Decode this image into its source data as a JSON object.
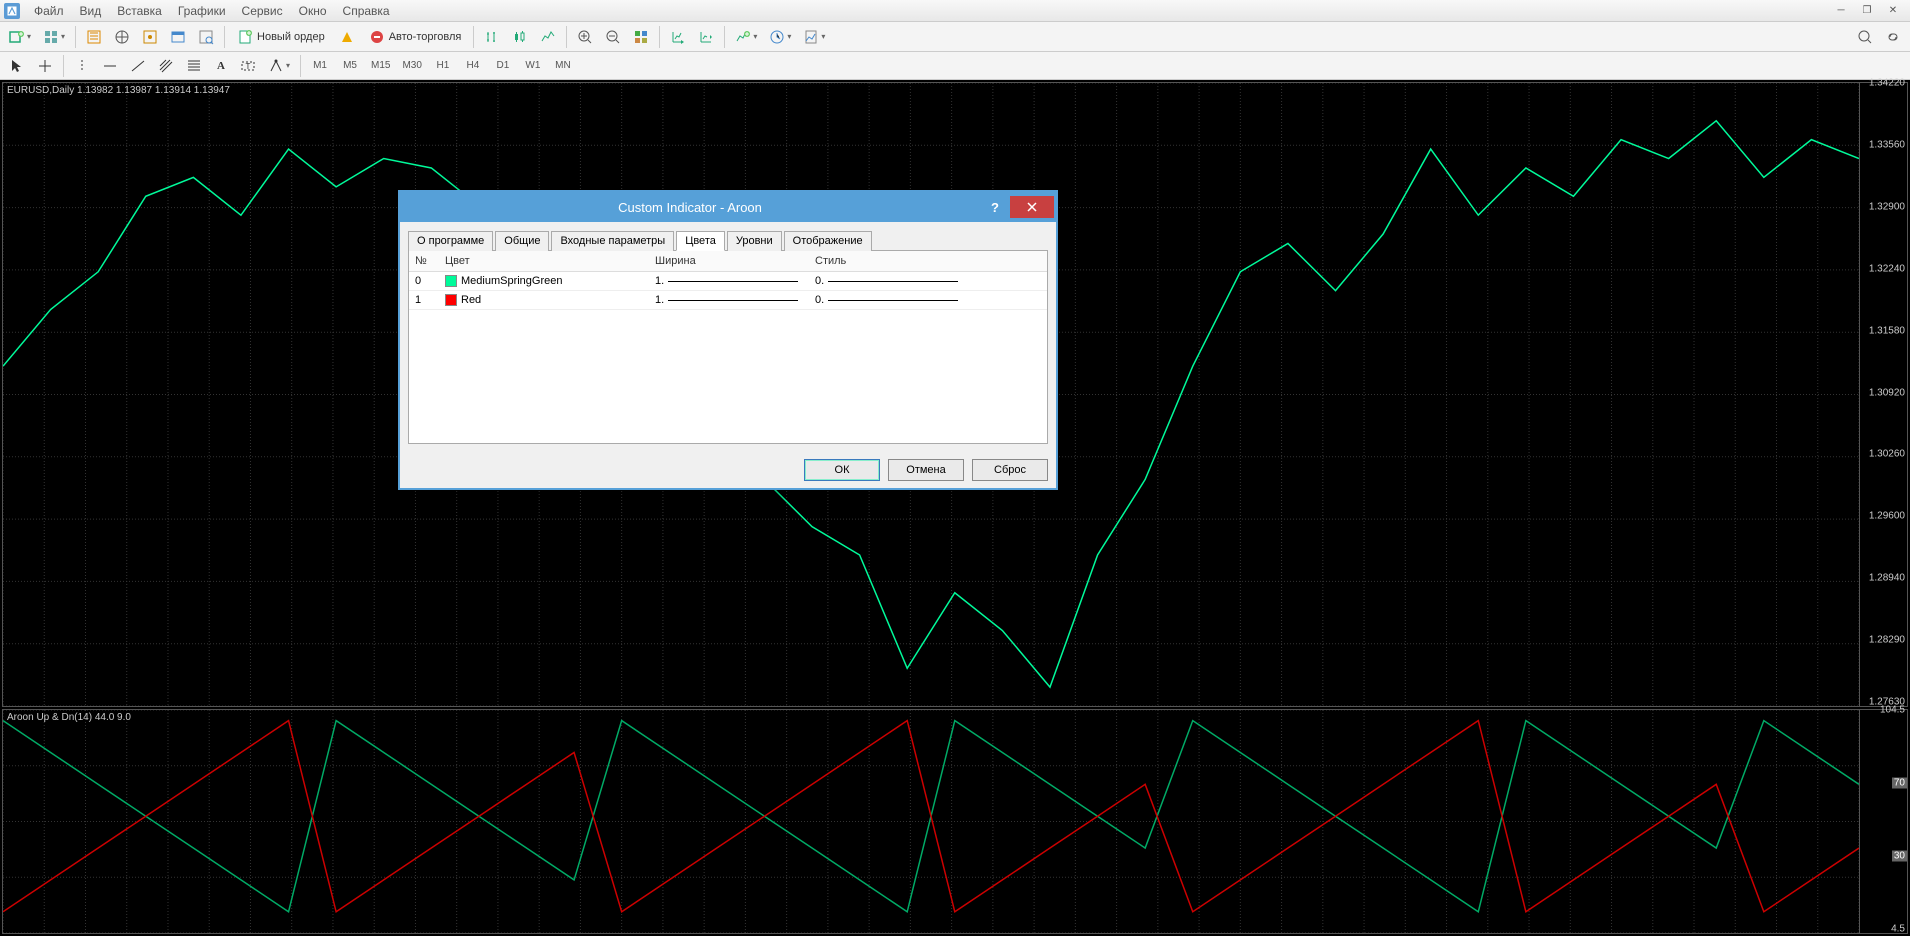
{
  "menu": {
    "items": [
      "Файл",
      "Вид",
      "Вставка",
      "Графики",
      "Сервис",
      "Окно",
      "Справка"
    ]
  },
  "toolbar1": {
    "new_order": "Новый ордер",
    "auto_trade": "Авто-торговля"
  },
  "timeframes": [
    "M1",
    "M5",
    "M15",
    "M30",
    "H1",
    "H4",
    "D1",
    "W1",
    "MN"
  ],
  "main_chart": {
    "label": "EURUSD,Daily  1.13982 1.13987 1.13914 1.13947",
    "y_ticks": [
      "1.34220",
      "1.33560",
      "1.32900",
      "1.32240",
      "1.31580",
      "1.30920",
      "1.30260",
      "1.29600",
      "1.28940",
      "1.28290",
      "1.27630"
    ]
  },
  "indicator_chart": {
    "label": "Aroon Up & Dn(14) 44.0 9.0",
    "y_ticks": [
      {
        "v": "104.5",
        "boxed": false
      },
      {
        "v": "70",
        "boxed": true
      },
      {
        "v": "30",
        "boxed": true
      },
      {
        "v": "4.5",
        "boxed": false
      }
    ]
  },
  "dialog": {
    "title": "Custom Indicator - Aroon",
    "tabs": [
      "О программе",
      "Общие",
      "Входные параметры",
      "Цвета",
      "Уровни",
      "Отображение"
    ],
    "active_tab": 3,
    "columns": [
      "№",
      "Цвет",
      "Ширина",
      "Стиль"
    ],
    "rows": [
      {
        "idx": "0",
        "color": "#00FA9A",
        "name": "MediumSpringGreen",
        "width": "1.",
        "style": "0."
      },
      {
        "idx": "1",
        "color": "#FF0000",
        "name": "Red",
        "width": "1.",
        "style": "0."
      }
    ],
    "buttons": {
      "ok": "ОК",
      "cancel": "Отмена",
      "reset": "Сброс"
    }
  },
  "chart_data": {
    "type": "line",
    "main": {
      "series": [
        {
          "name": "EURUSD",
          "color": "#00fa9a",
          "values": [
            1.312,
            1.318,
            1.322,
            1.33,
            1.332,
            1.328,
            1.335,
            1.331,
            1.334,
            1.333,
            1.329,
            1.326,
            1.318,
            1.312,
            1.318,
            1.316,
            1.3,
            1.295,
            1.292,
            1.28,
            1.288,
            1.284,
            1.278,
            1.292,
            1.3,
            1.312,
            1.322,
            1.325,
            1.32,
            1.326,
            1.335,
            1.328,
            1.333,
            1.33,
            1.336,
            1.334,
            1.338,
            1.332,
            1.336,
            1.334
          ]
        }
      ],
      "ylim": [
        1.276,
        1.342
      ]
    },
    "aroon": {
      "series": [
        {
          "name": "Aroon Up",
          "color": "#0a6",
          "values": [
            100,
            85,
            70,
            55,
            40,
            25,
            10,
            100,
            85,
            70,
            55,
            40,
            25,
            100,
            85,
            70,
            55,
            40,
            25,
            10,
            100,
            85,
            70,
            55,
            40,
            100,
            85,
            70,
            55,
            40,
            25,
            10,
            100,
            85,
            70,
            55,
            40,
            100,
            85,
            70
          ]
        },
        {
          "name": "Aroon Dn",
          "color": "#c00",
          "values": [
            10,
            25,
            40,
            55,
            70,
            85,
            100,
            10,
            25,
            40,
            55,
            70,
            85,
            10,
            25,
            40,
            55,
            70,
            85,
            100,
            10,
            25,
            40,
            55,
            70,
            10,
            25,
            40,
            55,
            70,
            85,
            100,
            10,
            25,
            40,
            55,
            70,
            10,
            25,
            40
          ]
        }
      ],
      "ylim": [
        0,
        105
      ]
    }
  }
}
